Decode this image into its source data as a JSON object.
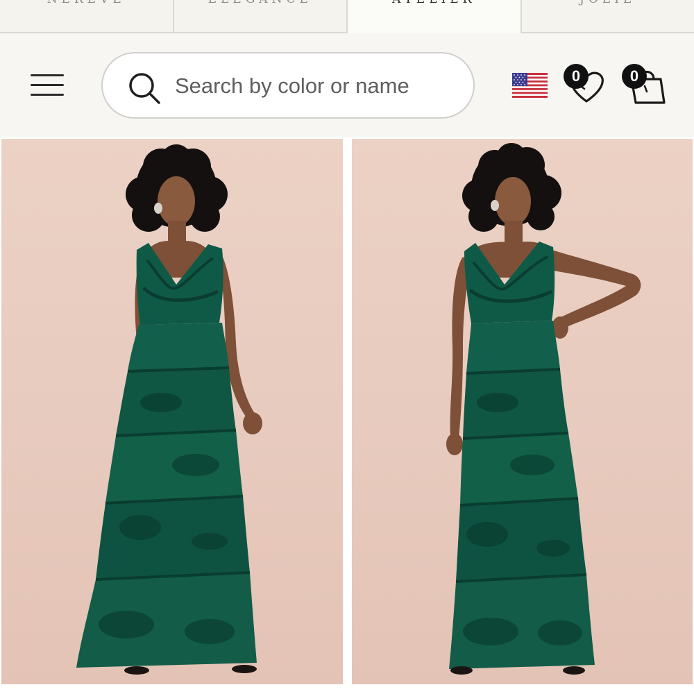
{
  "brand_tabs": [
    {
      "label": "NEREVE",
      "active": false
    },
    {
      "label": "ELEGANCE",
      "active": false
    },
    {
      "label": "ATELIER",
      "active": true
    },
    {
      "label": "JOLIE",
      "active": false
    }
  ],
  "header": {
    "search": {
      "placeholder": "Search by color or name",
      "icon": "search-icon"
    },
    "menu_icon": "hamburger-menu-icon",
    "country_flag": "us-flag-icon",
    "wishlist": {
      "icon": "heart-icon",
      "count": "0"
    },
    "cart": {
      "icon": "shopping-bag-icon",
      "count": "0"
    }
  },
  "products": [
    {
      "image": "model-green-tiered-maxi-dress-front",
      "dress_color": "#0f5a46"
    },
    {
      "image": "model-green-tiered-maxi-dress-hand-on-hip",
      "dress_color": "#0f5a46"
    }
  ],
  "colors": {
    "background_header": "#f7f6f2",
    "image_backdrop": "#e8cbbf",
    "badge": "#111111",
    "dress_green": "#0f5a46"
  }
}
